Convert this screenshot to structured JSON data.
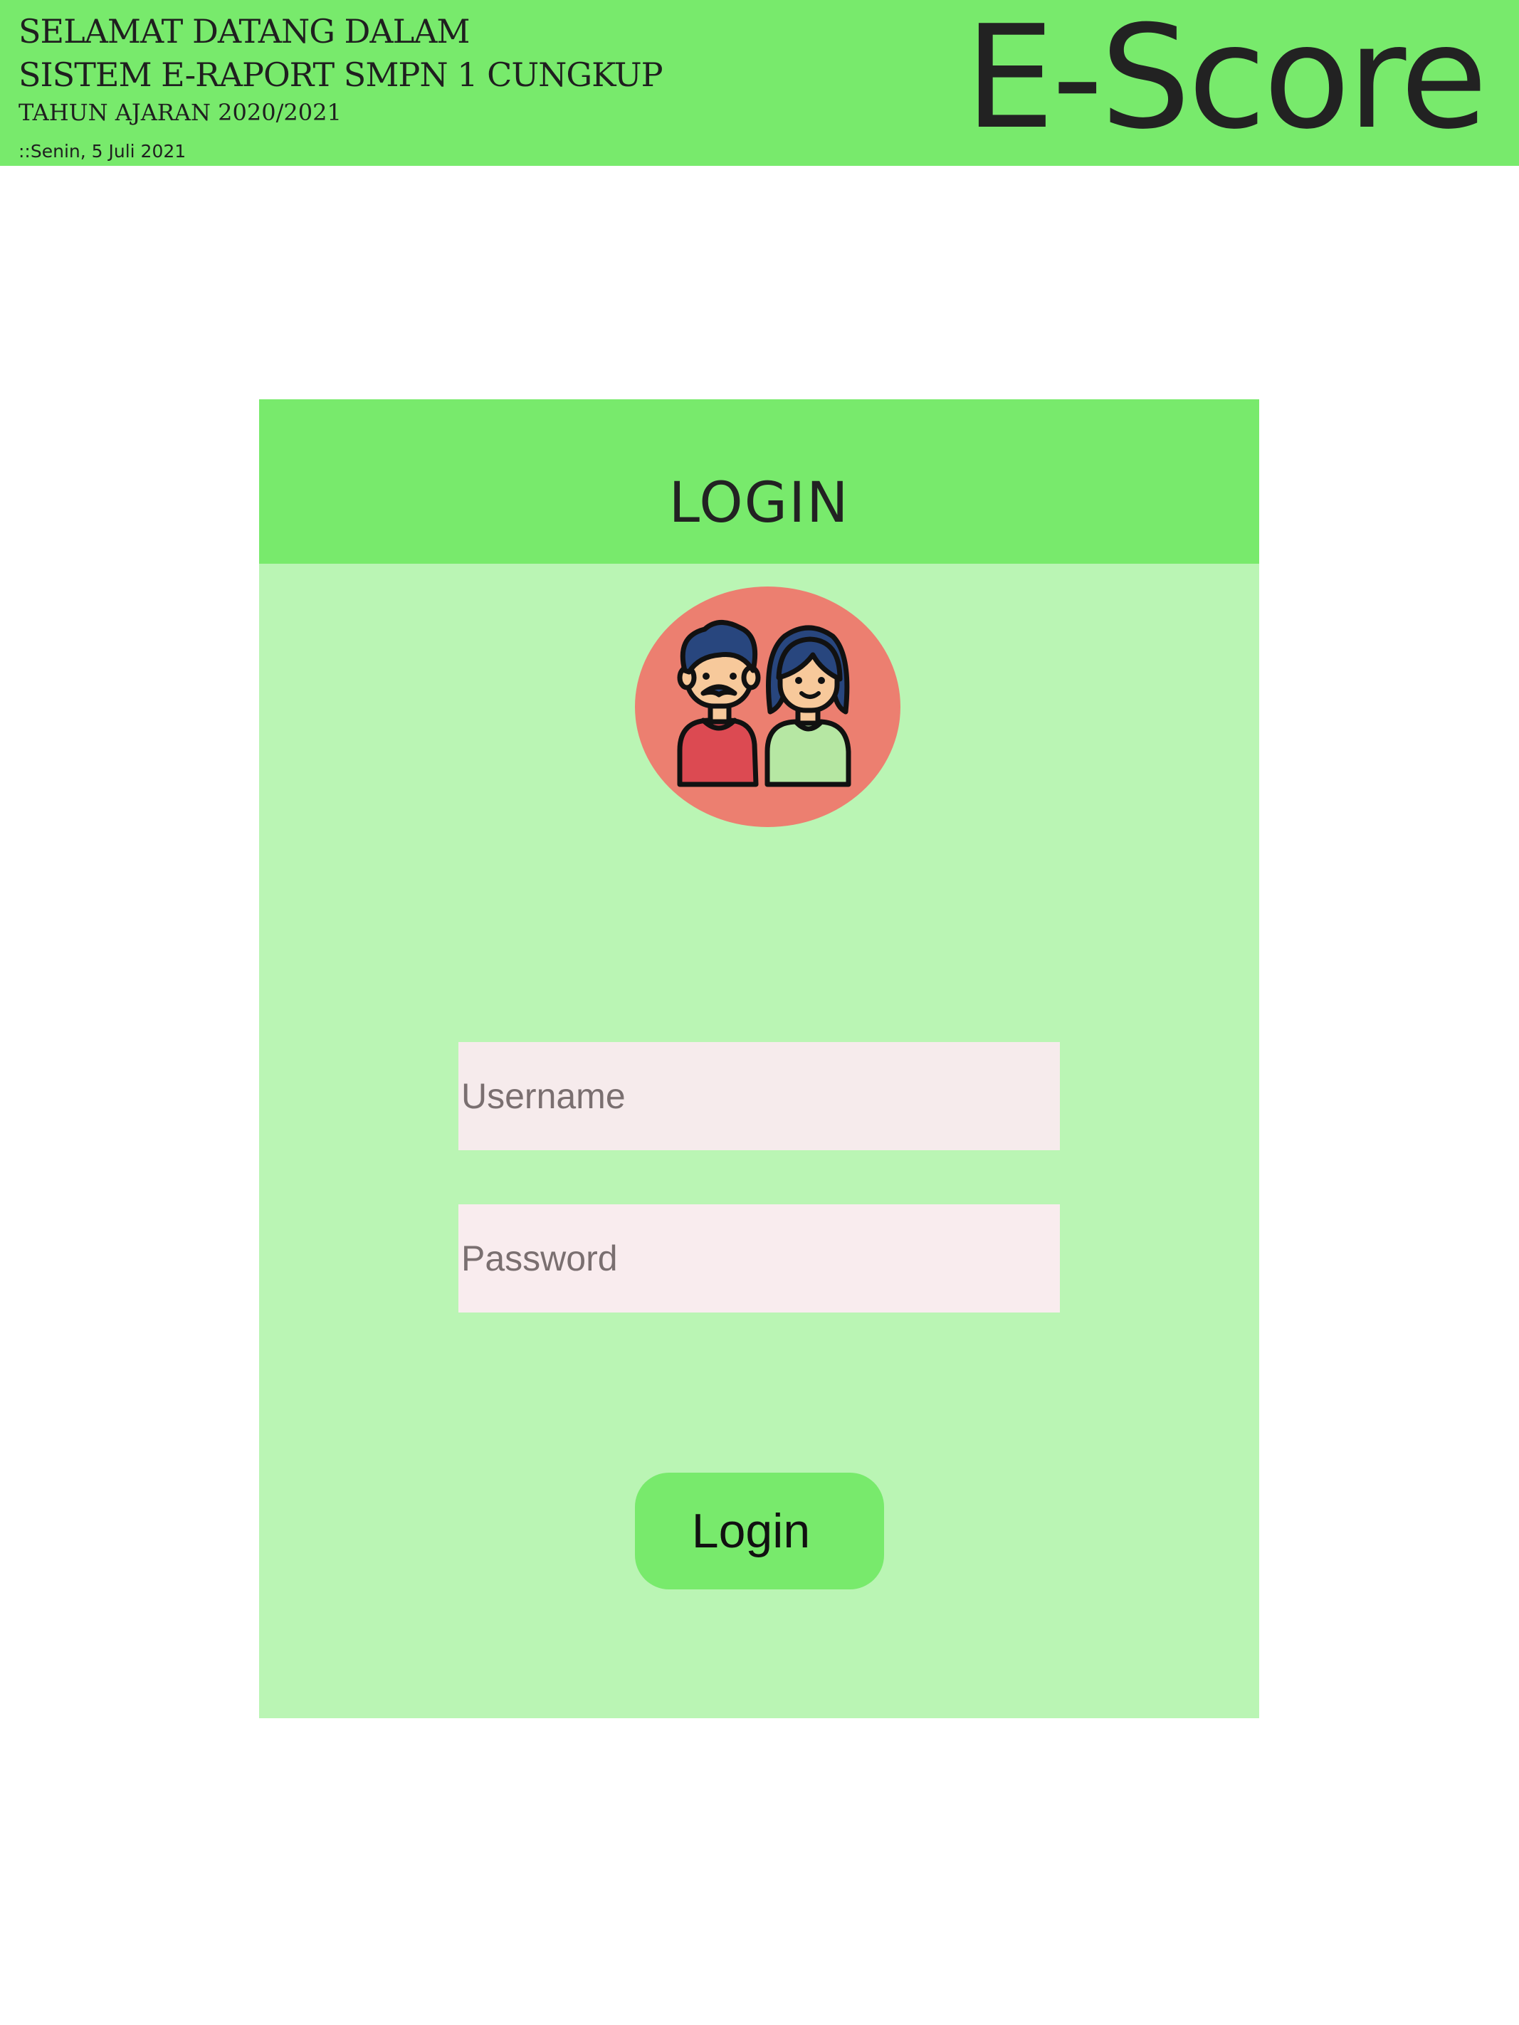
{
  "header": {
    "welcome_line_1": "SELAMAT DATANG DALAM",
    "welcome_line_2": "SISTEM E-RAPORT SMPN 1 CUNGKUP",
    "academic_year": "TAHUN AJARAN 2020/2021",
    "date": "::Senin, 5 Juli 2021",
    "brand": "E-Score"
  },
  "login_card": {
    "title": "LOGIN",
    "avatar_icon": "couple-avatar-icon",
    "username_placeholder": "Username",
    "username_value": "",
    "password_placeholder": "Password",
    "password_value": "",
    "login_button_label": "Login"
  },
  "colors": {
    "header_bg": "#78ea6c",
    "card_bg": "#baf5b4",
    "avatar_circle": "#ec7f70",
    "input_bg": "#f6ebec",
    "text_dark": "#222222"
  }
}
